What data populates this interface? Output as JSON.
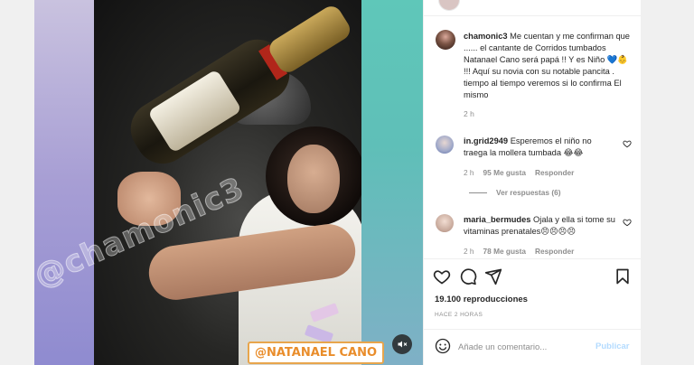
{
  "post": {
    "username": "chamonic3",
    "caption": "Me cuentan y me confirman que ...... el cantante de Corridos tumbados Natanael Cano será papá !! Y es Niño 💙👶 !!! Aquí su novia con su notable pancita . tiempo al tiempo veremos si lo confirma El mismo",
    "time": "2 h"
  },
  "comments": [
    {
      "username": "in.grid2949",
      "text": "Esperemos el niño no traega la mollera tumbada 😂😂",
      "time": "2 h",
      "likes": "95 Me gusta",
      "reply_label": "Responder",
      "view_replies": "Ver respuestas (6)"
    },
    {
      "username": "maria_bermudes",
      "text": "Ojala y ella si tome su vitaminas prenatales😣😣😣😣",
      "time": "2 h",
      "likes": "78 Me gusta",
      "reply_label": "Responder"
    }
  ],
  "stats": {
    "views": "19.100 reproducciones",
    "posted_ago": "HACE 2 HORAS"
  },
  "composer": {
    "placeholder": "Añade un comentario...",
    "publish_label": "Publicar"
  },
  "media": {
    "watermark": "@chamonic3",
    "tag": "@NATANAEL CANO"
  },
  "icons": {
    "like": "heart-icon",
    "comment": "comment-bubble-icon",
    "share": "paper-plane-icon",
    "save": "bookmark-icon",
    "mute": "speaker-muted-icon",
    "emoji": "smiley-icon"
  },
  "colors": {
    "publish_disabled": "#b3dbff",
    "tag_orange": "#e98d2b",
    "text": "#262626",
    "muted": "#8e8e8e"
  }
}
